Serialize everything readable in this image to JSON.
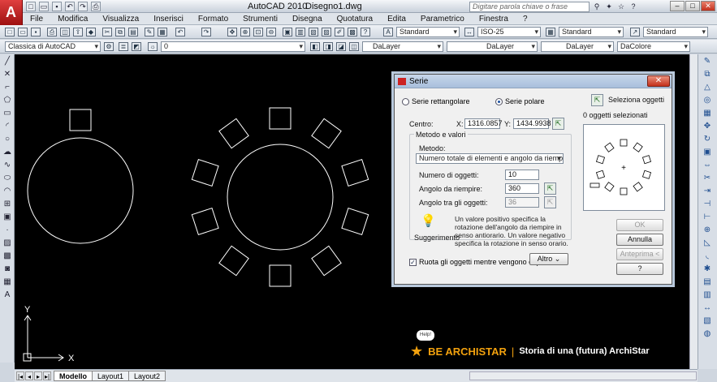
{
  "app": {
    "logo": "A",
    "name": "AutoCAD 2010",
    "file": "Disegno1.dwg",
    "search_placeholder": "Digitare parola chiave o frase"
  },
  "menu": [
    "File",
    "Modifica",
    "Visualizza",
    "Inserisci",
    "Formato",
    "Strumenti",
    "Disegna",
    "Quotatura",
    "Edita",
    "Parametrico",
    "Finestra",
    "?"
  ],
  "toolbar": {
    "text_style": "Standard",
    "dim_style": "ISO-25",
    "table_style": "Standard",
    "multileader_style": "Standard",
    "workspace": "Classica di AutoCAD",
    "layer": "0",
    "color": "DaLayer",
    "linetype": "DaLayer",
    "lineweight": "DaLayer",
    "plot_style": "DaColore"
  },
  "tabs": [
    "Modello",
    "Layout1",
    "Layout2"
  ],
  "ucs": {
    "x_label": "X",
    "y_label": "Y"
  },
  "dialog": {
    "title": "Serie",
    "radio_rect": "Serie rettangolare",
    "radio_polar": "Serie polare",
    "select_objects": "Seleziona oggetti",
    "selected_count": "0 oggetti selezionati",
    "center_label": "Centro:",
    "x_label": "X:",
    "x_value": "1316.0857",
    "y_label": "Y:",
    "y_value": "1434.9938",
    "method_group": "Metodo e valori",
    "method_label": "Metodo:",
    "method_value": "Numero totale di elementi e angolo da riempire",
    "num_items_label": "Numero di oggetti:",
    "num_items": "10",
    "angle_fill_label": "Angolo da riempire:",
    "angle_fill": "360",
    "angle_between_label": "Angolo tra gli oggetti:",
    "angle_between": "36",
    "tip_title": "Suggerimento",
    "tip_text": "Un valore positivo specifica la rotazione dell'angolo da riempire in senso antiorario. Un valore negativo specifica la rotazione in senso orario.",
    "rotate_label": "Ruota gli oggetti mentre vengono copiati",
    "rotate_checked": true,
    "more_button": "Altro",
    "ok": "OK",
    "cancel": "Annulla",
    "preview": "Anteprima <",
    "help": "?"
  },
  "watermark": {
    "help_bubble": "Help!",
    "brand": "BE ARCHISTAR",
    "separator": "|",
    "tagline": "Storia di una (futura) ArchiStar"
  }
}
